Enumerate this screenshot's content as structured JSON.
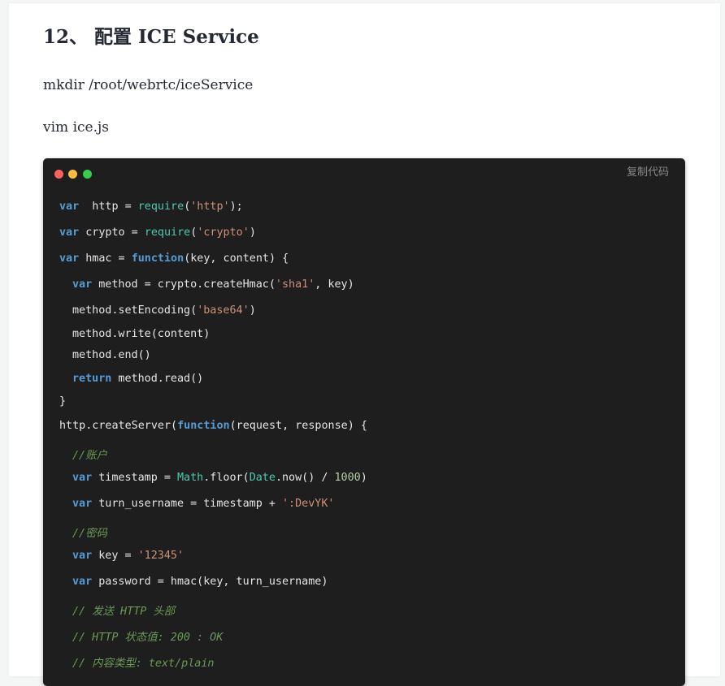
{
  "article": {
    "heading": "12、 配置 ICE Service",
    "paragraphs": [
      "mkdir /root/webrtc/iceService",
      "vim ice.js"
    ]
  },
  "code_block": {
    "copy_label": "复制代码",
    "window_dot_colors": [
      "#fc625d",
      "#fdbc40",
      "#35cd4b"
    ],
    "theme_colors": {
      "background": "#1e1e1e",
      "keyword": "#569cd6",
      "builtin": "#4ec9b0",
      "string": "#ce9178",
      "number": "#b5cea8",
      "comment": "#6a9955",
      "plain": "#e6e6e6"
    },
    "lines": [
      {
        "indent": 0,
        "tokens": [
          [
            "kw",
            "var"
          ],
          [
            "",
            "  http = "
          ],
          [
            "fn",
            "require"
          ],
          [
            "",
            "("
          ],
          [
            "str",
            "'http'"
          ],
          [
            "",
            ");"
          ]
        ]
      },
      {
        "indent": 0,
        "tokens": [
          [
            "kw",
            "var"
          ],
          [
            "",
            " crypto = "
          ],
          [
            "fn",
            "require"
          ],
          [
            "",
            "("
          ],
          [
            "str",
            "'crypto'"
          ],
          [
            "",
            ")"
          ]
        ]
      },
      {
        "indent": 0,
        "tokens": [
          [
            "kw",
            "var"
          ],
          [
            "",
            " hmac = "
          ],
          [
            "kw",
            "function"
          ],
          [
            "",
            "(key, content) {"
          ]
        ]
      },
      {
        "indent": 1,
        "tokens": [
          [
            "kw",
            "var"
          ],
          [
            "",
            " method = crypto.createHmac("
          ],
          [
            "str",
            "'sha1'"
          ],
          [
            "",
            ", key)"
          ]
        ]
      },
      {
        "indent": 1,
        "tokens": [
          [
            "",
            "method.setEncoding("
          ],
          [
            "str",
            "'base64'"
          ],
          [
            "",
            ")"
          ]
        ]
      },
      {
        "indent": 1,
        "tokens": [
          [
            "",
            "method.write(content)"
          ]
        ]
      },
      {
        "indent": 1,
        "tokens": [
          [
            "",
            "method.end()"
          ]
        ]
      },
      {
        "indent": 1,
        "tokens": [
          [
            "kw",
            "return"
          ],
          [
            "",
            " method.read()"
          ]
        ]
      },
      {
        "indent": 0,
        "tokens": [
          [
            "",
            "}"
          ]
        ]
      },
      {
        "indent": 0,
        "tokens": [
          [
            "",
            "http.createServer("
          ],
          [
            "kw",
            "function"
          ],
          [
            "",
            "(request, response) {"
          ]
        ]
      },
      {
        "indent": 1,
        "tokens": [
          [
            "cm",
            "//账户"
          ]
        ]
      },
      {
        "indent": 1,
        "tokens": [
          [
            "kw",
            "var"
          ],
          [
            "",
            " timestamp = "
          ],
          [
            "fn",
            "Math"
          ],
          [
            "",
            ".floor("
          ],
          [
            "fn",
            "Date"
          ],
          [
            "",
            ".now() / "
          ],
          [
            "num",
            "1000"
          ],
          [
            "",
            ")"
          ]
        ]
      },
      {
        "indent": 1,
        "tokens": [
          [
            "kw",
            "var"
          ],
          [
            "",
            " turn_username = timestamp + "
          ],
          [
            "str",
            "':DevYK'"
          ]
        ]
      },
      {
        "indent": 1,
        "tokens": [
          [
            "cm",
            "//密码"
          ]
        ]
      },
      {
        "indent": 1,
        "tokens": [
          [
            "kw",
            "var"
          ],
          [
            "",
            " key = "
          ],
          [
            "str",
            "'12345'"
          ]
        ]
      },
      {
        "indent": 1,
        "tokens": [
          [
            "kw",
            "var"
          ],
          [
            "",
            " password = hmac(key, turn_username)"
          ]
        ]
      },
      {
        "indent": 1,
        "tokens": [
          [
            "cm",
            "// 发送 HTTP 头部"
          ]
        ]
      },
      {
        "indent": 1,
        "tokens": [
          [
            "cm",
            "// HTTP 状态值: 200 : OK"
          ]
        ]
      },
      {
        "indent": 1,
        "tokens": [
          [
            "cm",
            "// 内容类型: text/plain"
          ]
        ]
      }
    ]
  }
}
